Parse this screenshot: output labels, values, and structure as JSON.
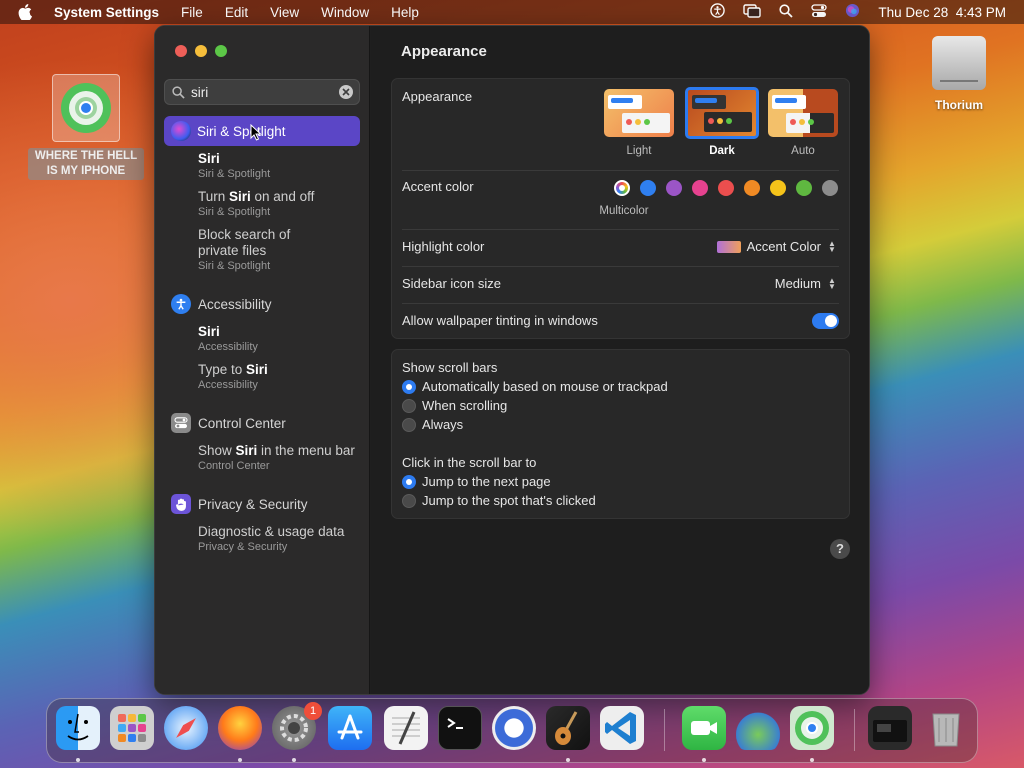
{
  "menubar": {
    "app_name": "System Settings",
    "menus": [
      "File",
      "Edit",
      "View",
      "Window",
      "Help"
    ],
    "status_icons": [
      "accessibility-icon",
      "screen-mirroring-icon",
      "spotlight-icon",
      "control-center-icon",
      "siri-icon"
    ],
    "clock": "Thu Dec 28  4:43 PM"
  },
  "desktop": {
    "findmy_label_line1": "WHERE THE HELL",
    "findmy_label_line2": "IS MY IPHONE",
    "thorium_label": "Thorium"
  },
  "sidebar": {
    "search_value": "siri",
    "top_result": "Siri & Spotlight",
    "groups": [
      {
        "title": "Accessibility",
        "icon": "accessibility-icon"
      },
      {
        "title": "Control Center",
        "icon": "control-center-icon"
      },
      {
        "title": "Privacy & Security",
        "icon": "hand-icon"
      }
    ],
    "siri_results": [
      {
        "pre": "",
        "hl": "Siri",
        "post": "",
        "sub": "Siri & Spotlight"
      },
      {
        "pre": "Turn ",
        "hl": "Siri",
        "post": " on and off",
        "sub": "Siri & Spotlight"
      },
      {
        "pre": "Block search of",
        "hl": "",
        "post": "",
        "line2": "private files",
        "sub": "Siri & Spotlight"
      },
      {
        "pre": "",
        "hl": "Siri",
        "post": "",
        "sub": "Accessibility"
      },
      {
        "pre": "Type to ",
        "hl": "Siri",
        "post": "",
        "sub": "Accessibility"
      },
      {
        "pre": "Show ",
        "hl": "Siri",
        "post": " in the menu bar",
        "sub": "Control Center"
      },
      {
        "pre": "Diagnostic & usage data",
        "hl": "",
        "post": "",
        "sub": "Privacy & Security"
      }
    ]
  },
  "content": {
    "title": "Appearance",
    "appearance_label": "Appearance",
    "appearance_options": [
      "Light",
      "Dark",
      "Auto"
    ],
    "appearance_selected": "Dark",
    "accent_label": "Accent color",
    "accent_selected_name": "Multicolor",
    "accent_colors": [
      "#ffffff",
      "#2f7ff0",
      "#9b55c6",
      "#e6428f",
      "#eb4e4e",
      "#f08a24",
      "#f5c31a",
      "#5fb840",
      "#8c8c8c"
    ],
    "highlight_label": "Highlight color",
    "highlight_value": "Accent Color",
    "sidebar_icon_label": "Sidebar icon size",
    "sidebar_icon_value": "Medium",
    "tinting_label": "Allow wallpaper tinting in windows",
    "tinting_on": true,
    "scrollbars_label": "Show scroll bars",
    "scrollbars_options": [
      "Automatically based on mouse or trackpad",
      "When scrolling",
      "Always"
    ],
    "scrollbars_selected": 0,
    "click_label": "Click in the scroll bar to",
    "click_options": [
      "Jump to the next page",
      "Jump to the spot that's clicked"
    ],
    "click_selected": 0,
    "help": "?"
  },
  "colors": {
    "accent_blue": "#2d7bf0",
    "selection_purple": "#5b46c6"
  },
  "dock": {
    "apps": [
      "finder-icon",
      "launchpad-icon",
      "safari-icon",
      "firefox-icon",
      "system-settings-icon",
      "app-store-icon",
      "textedit-icon",
      "terminal-icon",
      "chromium-icon",
      "garageband-icon",
      "vscode-icon",
      "facetime-icon",
      "app-icon",
      "findmy-icon",
      "downloads-folder-icon",
      "trash-icon"
    ],
    "settings_badge": "1"
  }
}
